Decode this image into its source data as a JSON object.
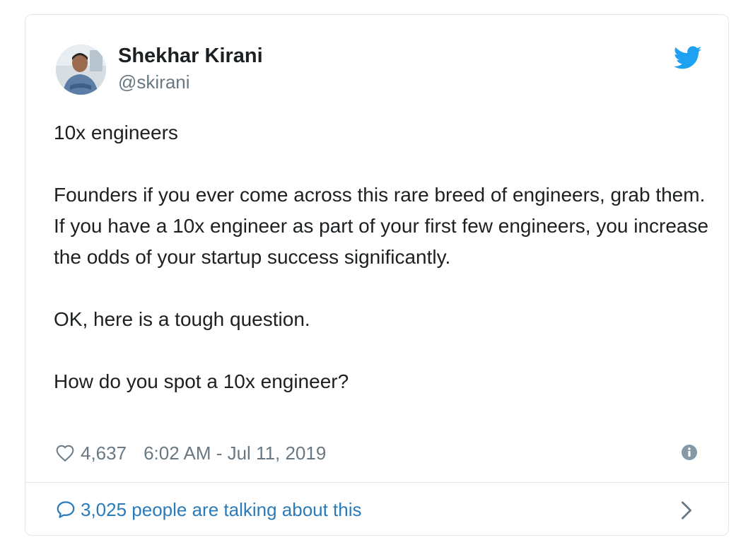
{
  "author": {
    "display_name": "Shekhar Kirani",
    "handle": "@skirani",
    "avatar_icon": "user-avatar-photo"
  },
  "brand": {
    "icon": "twitter-bird-icon",
    "color": "#1da1f2"
  },
  "tweet": {
    "paragraphs": [
      "10x engineers",
      "Founders if you ever come across this rare breed of engineers, grab them. If you have a 10x engineer as part of your first few engineers, you increase the odds of your startup success significantly.",
      "OK, here is a tough question.",
      "How do you spot a 10x engineer?"
    ]
  },
  "meta": {
    "like_count": "4,637",
    "timestamp": "6:02 AM - Jul 11, 2019",
    "like_icon": "heart-icon",
    "info_icon": "info-icon"
  },
  "conversation": {
    "label": "3,025 people are talking about this",
    "icon": "speech-bubble-icon",
    "color": "#2b7bb9"
  }
}
